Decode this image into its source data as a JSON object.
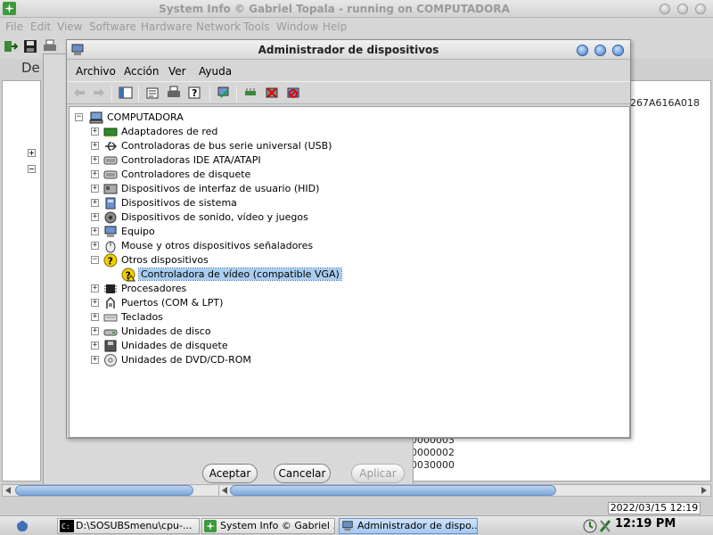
{
  "background_window": {
    "title": "System Info  © Gabriel Topala - running on COMPUTADORA",
    "menus": [
      "File",
      "Edit",
      "View",
      "Software",
      "Hardware",
      "Network",
      "Tools",
      "Window",
      "Help"
    ],
    "section_label": "De",
    "right_pane_values": [
      "267A616A018",
      "0000003",
      "0000002",
      "0030000"
    ],
    "datetime": "2022/03/15 12:19"
  },
  "background_dialog": {
    "ok_label": "Aceptar",
    "cancel_label": "Cancelar",
    "apply_label": "Aplicar"
  },
  "device_manager": {
    "title": "Administrador de dispositivos",
    "menus": [
      "Archivo",
      "Acción",
      "Ver",
      "Ayuda"
    ],
    "root": "COMPUTADORA",
    "categories": [
      {
        "label": "Adaptadores de red",
        "icon": "network-adapter-icon",
        "expander": "+"
      },
      {
        "label": "Controladoras de bus serie universal (USB)",
        "icon": "usb-icon",
        "expander": "+"
      },
      {
        "label": "Controladoras IDE ATA/ATAPI",
        "icon": "ide-controller-icon",
        "expander": "+"
      },
      {
        "label": "Controladores de disquete",
        "icon": "floppy-controller-icon",
        "expander": "+"
      },
      {
        "label": "Dispositivos de interfaz de usuario (HID)",
        "icon": "hid-icon",
        "expander": "+"
      },
      {
        "label": "Dispositivos de sistema",
        "icon": "system-device-icon",
        "expander": "+"
      },
      {
        "label": "Dispositivos de sonido, vídeo y juegos",
        "icon": "sound-icon",
        "expander": "+"
      },
      {
        "label": "Equipo",
        "icon": "computer-icon",
        "expander": "+"
      },
      {
        "label": "Mouse y otros dispositivos señaladores",
        "icon": "mouse-icon",
        "expander": "+"
      },
      {
        "label": "Otros dispositivos",
        "icon": "unknown-device-icon",
        "expander": "−"
      },
      {
        "label": "Controladora de vídeo (compatible VGA)",
        "icon": "warning-device-icon",
        "expander": ""
      },
      {
        "label": "Procesadores",
        "icon": "processor-icon",
        "expander": "+"
      },
      {
        "label": "Puertos (COM & LPT)",
        "icon": "port-icon",
        "expander": "+"
      },
      {
        "label": "Teclados",
        "icon": "keyboard-icon",
        "expander": "+"
      },
      {
        "label": "Unidades de disco",
        "icon": "disk-drive-icon",
        "expander": "+"
      },
      {
        "label": "Unidades de disquete",
        "icon": "floppy-drive-icon",
        "expander": "+"
      },
      {
        "label": "Unidades de DVD/CD-ROM",
        "icon": "dvd-drive-icon",
        "expander": "+"
      }
    ]
  },
  "taskbar": {
    "tasks": [
      {
        "label": "D:\\SOSUBSmenu\\cpu-..."
      },
      {
        "label": "System Info  © Gabriel ..."
      },
      {
        "label": "Administrador de dispo..."
      }
    ],
    "clock": "12:19 PM"
  }
}
